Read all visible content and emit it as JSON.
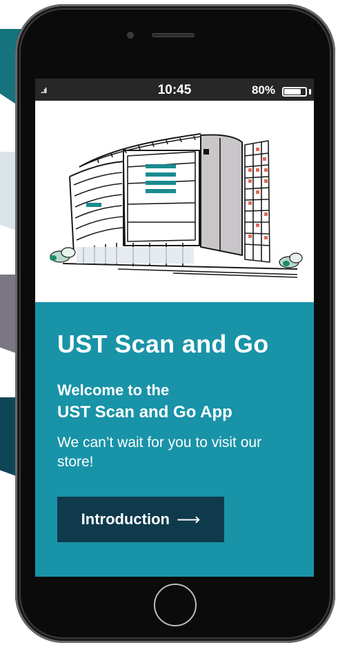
{
  "status_bar": {
    "signal": "..ıl",
    "time": "10:45",
    "battery_percent": "80%",
    "battery_level": 0.8
  },
  "hero": {
    "app_title": "UST Scan and Go",
    "welcome_line1": "Welcome to the",
    "welcome_line2": "UST Scan and Go App",
    "tagline": "We can’t wait for you to visit our store!",
    "intro_button_label": "Introduction",
    "intro_button_arrow": "⟶"
  },
  "colors": {
    "accent": "#1993a8",
    "button_dark": "#0e3a4c",
    "side_tab_1": "#14737c",
    "side_tab_2": "#dbe4e8",
    "side_tab_3": "#7b7782",
    "side_tab_4": "#0e4658",
    "status_bar": "#272727"
  },
  "icons": {
    "signal": "signal-bars-icon",
    "battery": "battery-icon",
    "illustration": "store-building-illustration",
    "home": "home-button"
  }
}
